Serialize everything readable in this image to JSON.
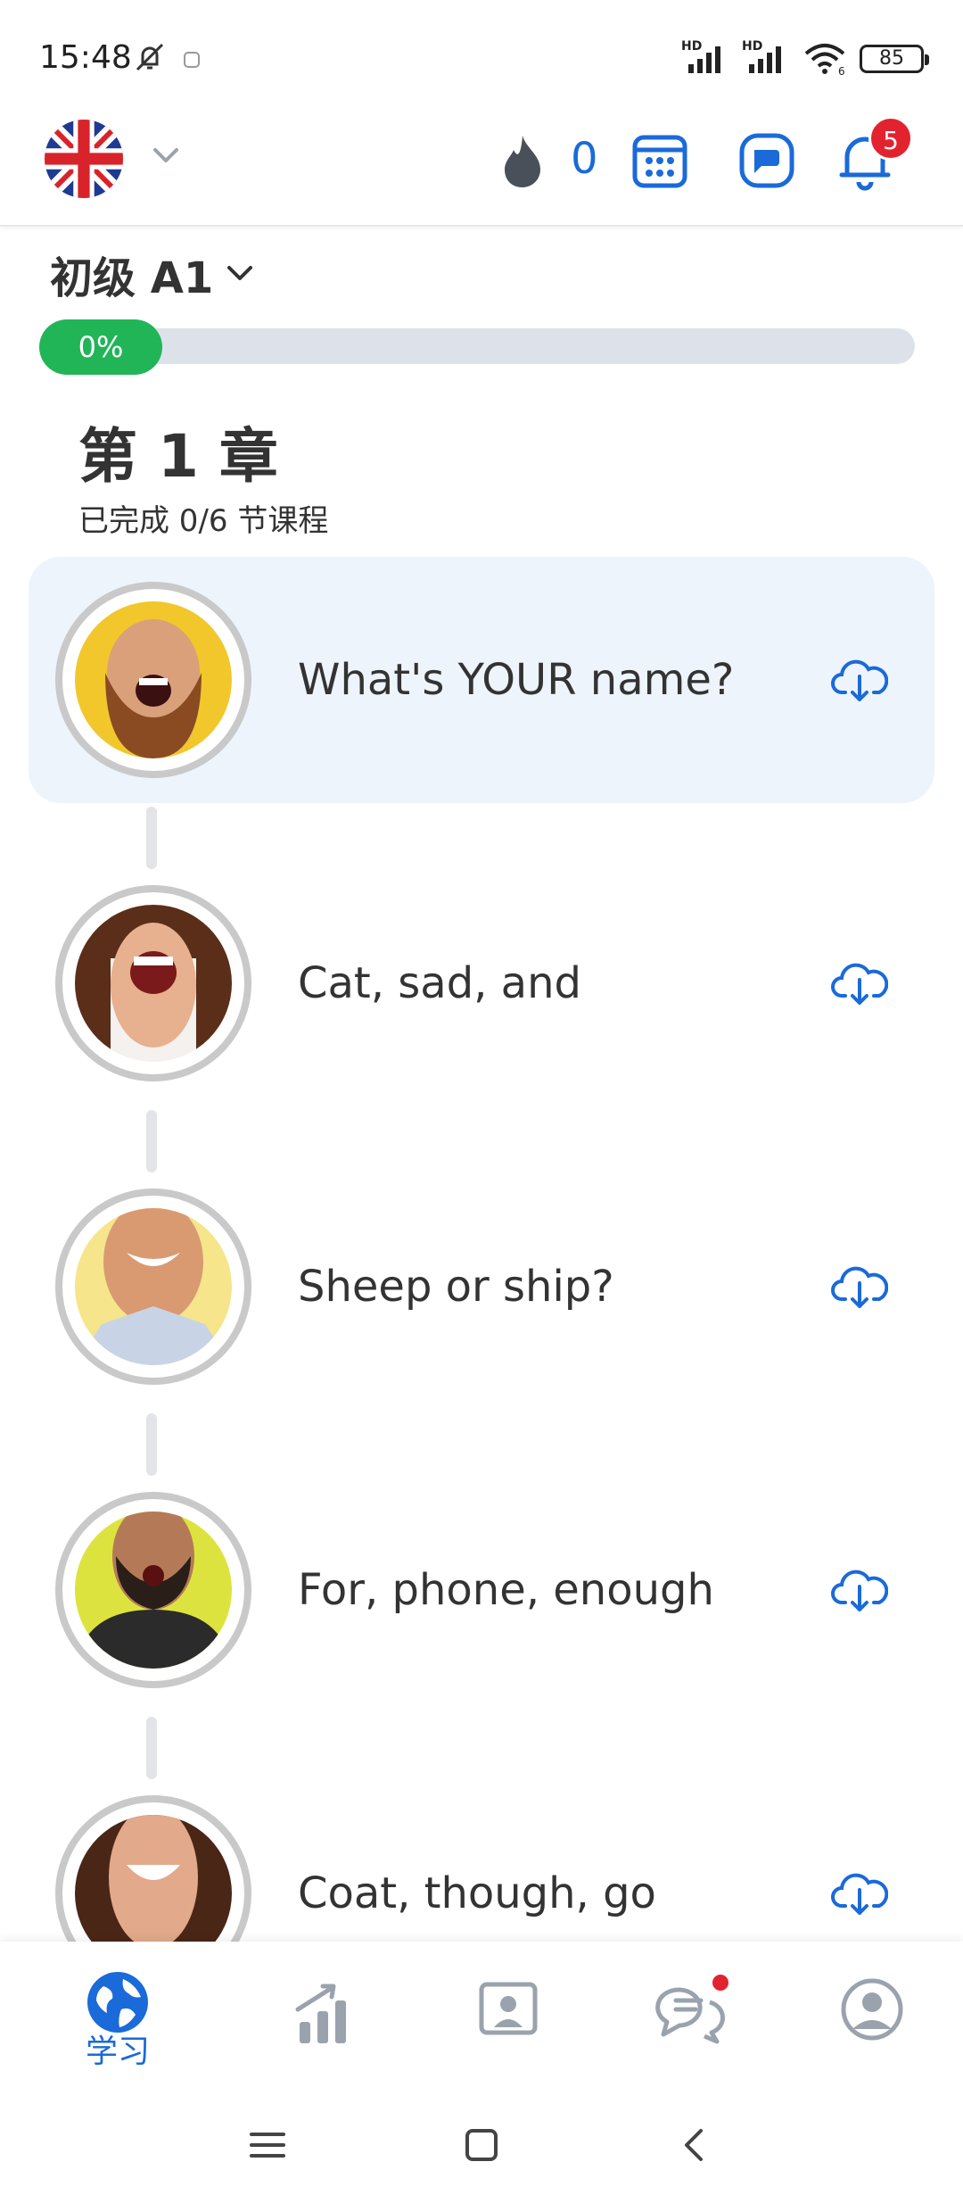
{
  "status": {
    "time": "15:48",
    "battery": "85",
    "hd1": "HD",
    "hd2": "HD",
    "wifi_label": "6"
  },
  "topbar": {
    "language": "United Kingdom flag",
    "streak_count": "0",
    "notifications_badge": "5"
  },
  "level": {
    "label": "初级 A1",
    "progress_label": "0%",
    "progress": 0
  },
  "chapter": {
    "title": "第 1 章",
    "subtitle": "已完成 0/6 节课程"
  },
  "lessons": [
    {
      "title": "What's YOUR name?"
    },
    {
      "title": "Cat, sad, and"
    },
    {
      "title": "Sheep or ship?"
    },
    {
      "title": "For, phone, enough"
    },
    {
      "title": "Coat, though, go"
    }
  ],
  "nav": {
    "learn_label": "学习"
  },
  "colors": {
    "accent": "#1a6ad9",
    "progress": "#21b558",
    "badge": "#e2232f",
    "active_card": "#eef4fb"
  }
}
